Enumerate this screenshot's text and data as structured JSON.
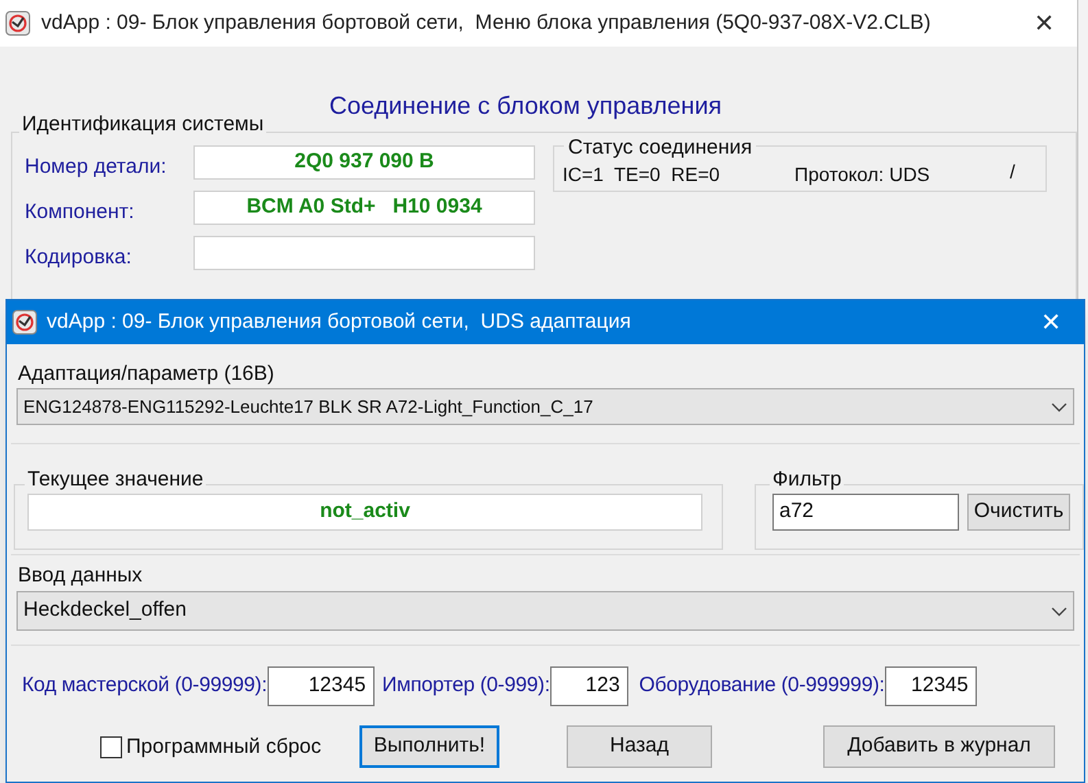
{
  "main_window": {
    "title": "vdApp : 09- Блок управления бортовой сети,  Меню блока управления (5Q0-937-08X-V2.CLB)",
    "close": "✕",
    "heading": "Соединение с блоком управления",
    "identification": {
      "title": "Идентификация системы",
      "fields": [
        {
          "label": "Номер детали:",
          "value": "2Q0 937 090 B"
        },
        {
          "label": "Компонент:",
          "value": "BCM A0 Std+   H10 0934"
        },
        {
          "label": "Кодировка:"
        }
      ]
    },
    "connection_status": {
      "title": "Статус соединения",
      "counters": "IC=1  TE=0  RE=0",
      "protocol": "Протокол: UDS",
      "mark": "/"
    }
  },
  "dialog": {
    "title": "vdApp : 09- Блок управления бортовой сети,  UDS адаптация",
    "close": "✕",
    "adaptation": {
      "label": "Адаптация/параметр (16В)",
      "value": "ENG124878-ENG115292-Leuchte17 BLK SR A72-Light_Function_C_17"
    },
    "current_value": {
      "label": "Текущее значение",
      "value": "not_activ"
    },
    "filter": {
      "label": "Фильтр",
      "value": "a72",
      "button": "Очистить"
    },
    "data_input": {
      "label": "Ввод данных",
      "value": "Heckdeckel_offen"
    },
    "codes": [
      {
        "label": "Код мастерской (0-99999):",
        "value": "12345"
      },
      {
        "label": "Импортер (0-999):",
        "value": "123"
      },
      {
        "label": "Оборудование (0-999999):",
        "value": "12345"
      }
    ],
    "reset": {
      "label": "Программный сброс",
      "checked": false
    },
    "buttons": [
      {
        "label": "Выполнить!",
        "focused": true
      },
      {
        "label": "Назад",
        "focused": false
      },
      {
        "label": "Добавить в журнал",
        "focused": false
      }
    ]
  }
}
